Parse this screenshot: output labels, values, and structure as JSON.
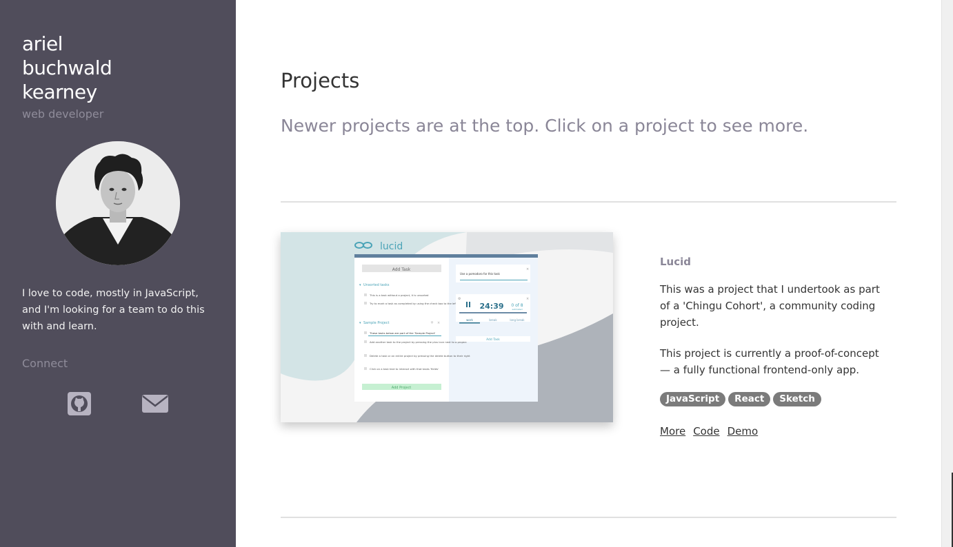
{
  "sidebar": {
    "name_line1": "ariel",
    "name_line2": "buchwald",
    "name_line3": "kearney",
    "role": "web developer",
    "bio": "I love to code, mostly in JavaScript, and I'm looking for a team to do this with and learn.",
    "connect_label": "Connect",
    "icons": [
      "github-icon",
      "mail-icon"
    ],
    "background_color": "#504d5b"
  },
  "main": {
    "title": "Projects",
    "subtitle": "Newer projects are at the top. Click on a project to see more.",
    "project": {
      "title": "Lucid",
      "description_1": "This was a project that I undertook as part of a 'Chingu Cohort', a community coding project.",
      "description_2": "This project is currently a proof-of-concept — a fully functional frontend-only app.",
      "tags": [
        "JavaScript",
        "React",
        "Sketch"
      ],
      "links": [
        "More",
        "Code",
        "Demo"
      ],
      "screenshot": {
        "logo_text": "lucid",
        "add_task_label": "Add Task",
        "unsorted_heading": "Unsorted tasks",
        "unsorted_tasks": [
          "This is a task without a project, it is unsorted",
          "Try to mark a task as completed by using the check box to the left"
        ],
        "project_heading": "Sample Project",
        "project_tasks": [
          "These tasks below are part of the 'Sample Project'",
          "Add another task to the project by pressing the plus icon next to a project",
          "Delete a task or an entire project by pressing the delete button to their right",
          "Click on a task text to interact with that tasks 'fields'"
        ],
        "add_project_label": "Add Project",
        "input_text": "Use a pomodoro for this task",
        "timer": "24:39",
        "pomodoro_count": "0 of 8",
        "pomodoro_count_sub": "estimated",
        "timer_tabs": [
          "work",
          "break",
          "long break"
        ],
        "add_task_right": "Add Task"
      }
    }
  }
}
